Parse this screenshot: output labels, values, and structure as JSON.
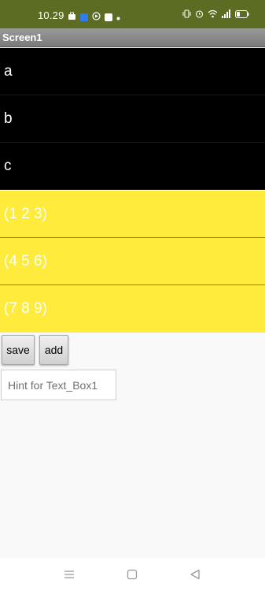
{
  "status_bar": {
    "time": "10.29",
    "left_icons": [
      "briefcase-icon",
      "messenger-icon",
      "tv-icon",
      "app-icon",
      "dot-icon"
    ],
    "right_icons": [
      "vibrate-icon",
      "alarm-icon",
      "wifi-icon",
      "signal-icon",
      "battery-icon"
    ],
    "bg_color": "#5c6c23"
  },
  "title_bar": {
    "title": "Screen1"
  },
  "list_view_1": {
    "bg_color": "#000000",
    "text_color": "#ffffff",
    "items": [
      "a",
      "b",
      "c"
    ]
  },
  "list_view_2": {
    "bg_color": "#ffeb3b",
    "text_color": "#ffffff",
    "items": [
      "(1 2 3)",
      "(4 5 6)",
      "(7 8 9)"
    ]
  },
  "buttons": {
    "save_label": "save",
    "add_label": "add"
  },
  "text_box": {
    "placeholder": "Hint for Text_Box1",
    "value": ""
  },
  "nav_bar": {
    "icons": [
      "menu-icon",
      "home-icon",
      "back-icon"
    ]
  }
}
